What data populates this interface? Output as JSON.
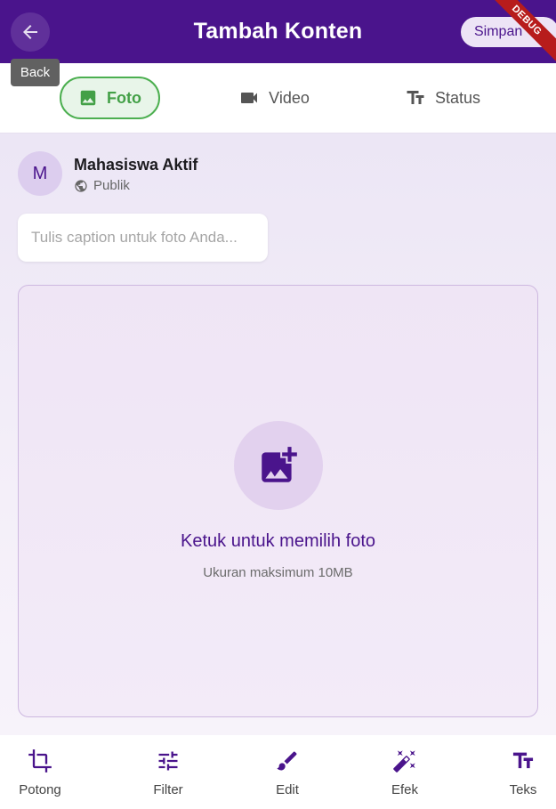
{
  "colors": {
    "primary": "#4a148c",
    "active_tab": "#43a047",
    "active_tab_bg": "#e8f5e9",
    "debug": "#b71c1c"
  },
  "appbar": {
    "title": "Tambah Konten",
    "back_icon": "arrow-back-icon",
    "back_tooltip": "Back",
    "save_label": "Simpan",
    "debug_label": "DEBUG"
  },
  "tabs": [
    {
      "label": "Foto",
      "icon": "image-icon",
      "active": true
    },
    {
      "label": "Video",
      "icon": "videocam-icon",
      "active": false
    },
    {
      "label": "Status",
      "icon": "text-fields-icon",
      "active": false
    }
  ],
  "user": {
    "initial": "M",
    "name": "Mahasiswa Aktif",
    "privacy": "Publik",
    "privacy_icon": "globe-icon"
  },
  "caption": {
    "placeholder": "Tulis caption untuk foto Anda...",
    "value": ""
  },
  "photo_picker": {
    "icon": "add-photo-icon",
    "title": "Ketuk untuk memilih foto",
    "subtitle": "Ukuran maksimum 10MB"
  },
  "tools": [
    {
      "label": "Potong",
      "icon": "crop-icon"
    },
    {
      "label": "Filter",
      "icon": "tune-icon"
    },
    {
      "label": "Edit",
      "icon": "brush-icon"
    },
    {
      "label": "Efek",
      "icon": "magic-wand-icon"
    },
    {
      "label": "Teks",
      "icon": "text-fields-icon"
    }
  ]
}
